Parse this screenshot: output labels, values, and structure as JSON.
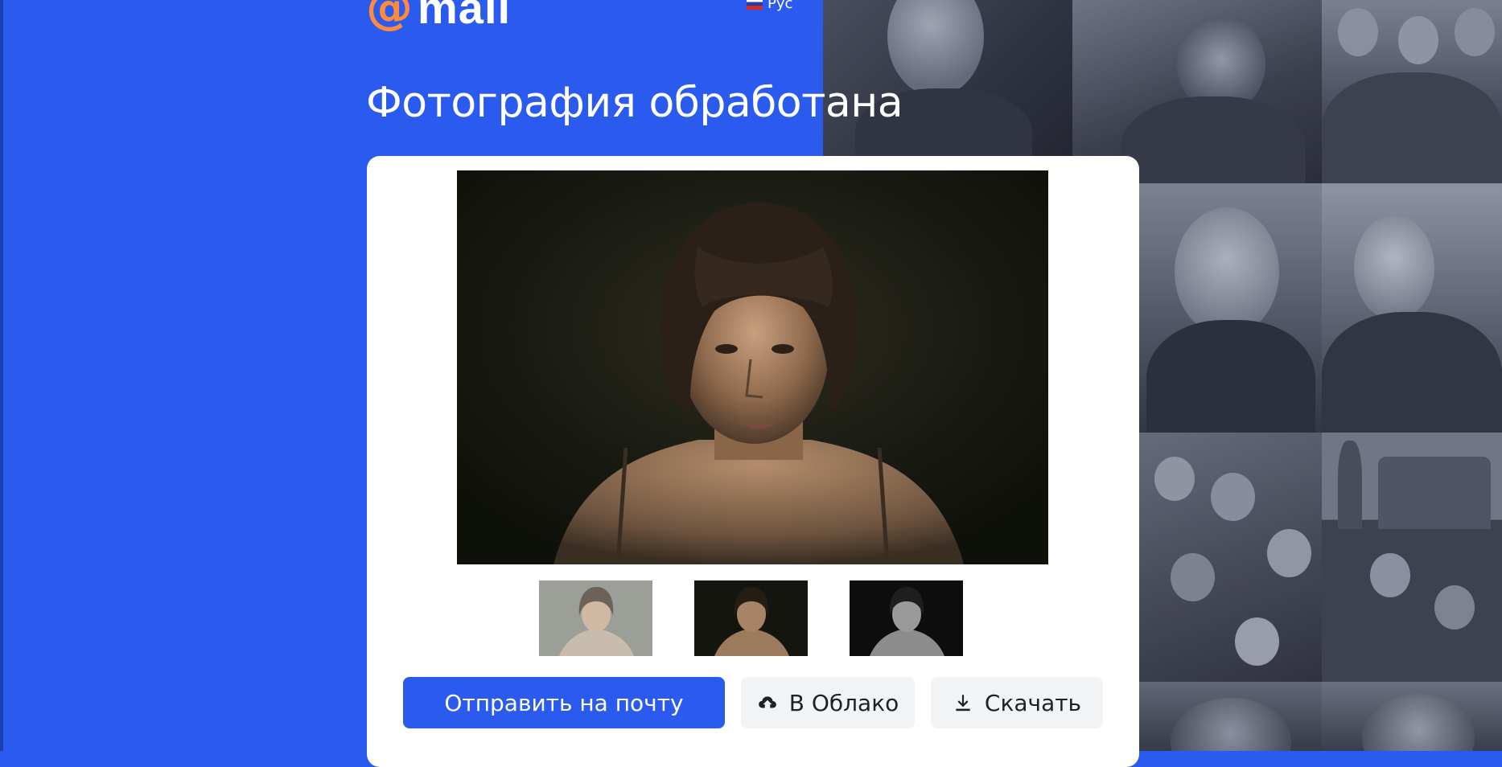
{
  "header": {
    "logo_symbol": "@",
    "logo_word": "mail",
    "lang_label": "Рус",
    "lang_flag_icon": "russia-flag-icon"
  },
  "page": {
    "title": "Фотография обработана"
  },
  "result": {
    "preview_alt": "processed portrait photo",
    "variants": [
      {
        "id": "variant-1",
        "style": "light-faded"
      },
      {
        "id": "variant-2",
        "style": "color"
      },
      {
        "id": "variant-3",
        "style": "black-and-white"
      }
    ]
  },
  "actions": {
    "send_label": "Отправить на почту",
    "cloud_label": "В Облако",
    "cloud_icon": "cloud-upload-icon",
    "download_label": "Скачать",
    "download_icon": "download-icon"
  },
  "colors": {
    "brand_blue": "#2b5bee",
    "logo_orange": "#ff8a3d",
    "card_bg": "#ffffff",
    "secondary_button_bg": "#f2f3f5"
  },
  "background_mosaic": {
    "description_tiles": [
      "archive-photo-woman-uniform",
      "archive-photo-soldier-binoculars",
      "archive-photo-pilots",
      "archive-photo-veteran-officer",
      "archive-photo-woman-medals",
      "archive-photo-soldiers-group",
      "archive-photo-red-square-crowd",
      "archive-photo-pilot-goggles"
    ]
  }
}
